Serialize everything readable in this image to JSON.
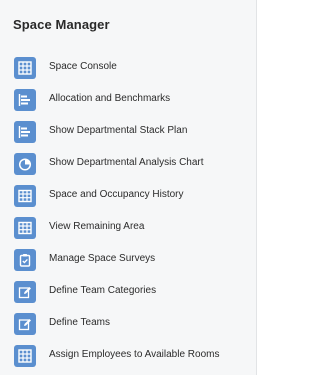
{
  "panel": {
    "title": "Space Manager"
  },
  "menu": {
    "items": [
      {
        "label": "Space Console",
        "icon": "grid-icon"
      },
      {
        "label": "Allocation and Benchmarks",
        "icon": "bars-icon"
      },
      {
        "label": "Show Departmental Stack Plan",
        "icon": "bars-icon"
      },
      {
        "label": "Show Departmental Analysis Chart",
        "icon": "pie-chart-icon"
      },
      {
        "label": "Space and Occupancy History",
        "icon": "table-icon"
      },
      {
        "label": "View Remaining Area",
        "icon": "table-icon"
      },
      {
        "label": "Manage Space Surveys",
        "icon": "clipboard-icon"
      },
      {
        "label": "Define Team Categories",
        "icon": "edit-icon"
      },
      {
        "label": "Define Teams",
        "icon": "edit-icon"
      },
      {
        "label": "Assign Employees to Available Rooms",
        "icon": "grid-icon"
      }
    ]
  },
  "colors": {
    "icon_bg": "#5b8fcf",
    "panel_bg": "#f6f7f8",
    "text": "#2b2b2b"
  }
}
